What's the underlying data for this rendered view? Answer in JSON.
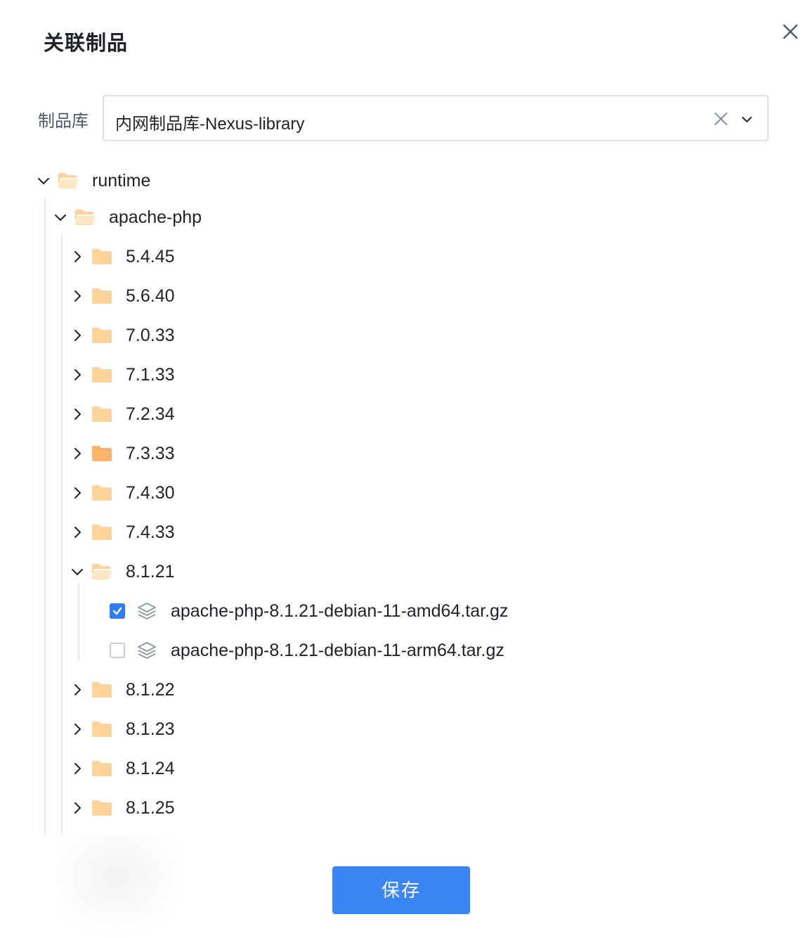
{
  "dialog": {
    "title": "关联制品",
    "save_label": "保存"
  },
  "repo_field": {
    "label": "制品库",
    "value": "内网制品库-Nexus-library"
  },
  "tree": {
    "root": "runtime",
    "package": "apache-php",
    "versions_before": [
      "5.4.45",
      "5.6.40",
      "7.0.33",
      "7.1.33",
      "7.2.34",
      "7.3.33",
      "7.4.30",
      "7.4.33"
    ],
    "expanded_version": "8.1.21",
    "files": [
      {
        "name": "apache-php-8.1.21-debian-11-amd64.tar.gz",
        "checked": true
      },
      {
        "name": "apache-php-8.1.21-debian-11-arm64.tar.gz",
        "checked": false
      }
    ],
    "versions_after": [
      "8.1.22",
      "8.1.23",
      "8.1.24",
      "8.1.25"
    ]
  },
  "colors": {
    "accent": "#3a86f7",
    "folder": "#ffd39a",
    "folder_hover": "#ffb46b"
  }
}
